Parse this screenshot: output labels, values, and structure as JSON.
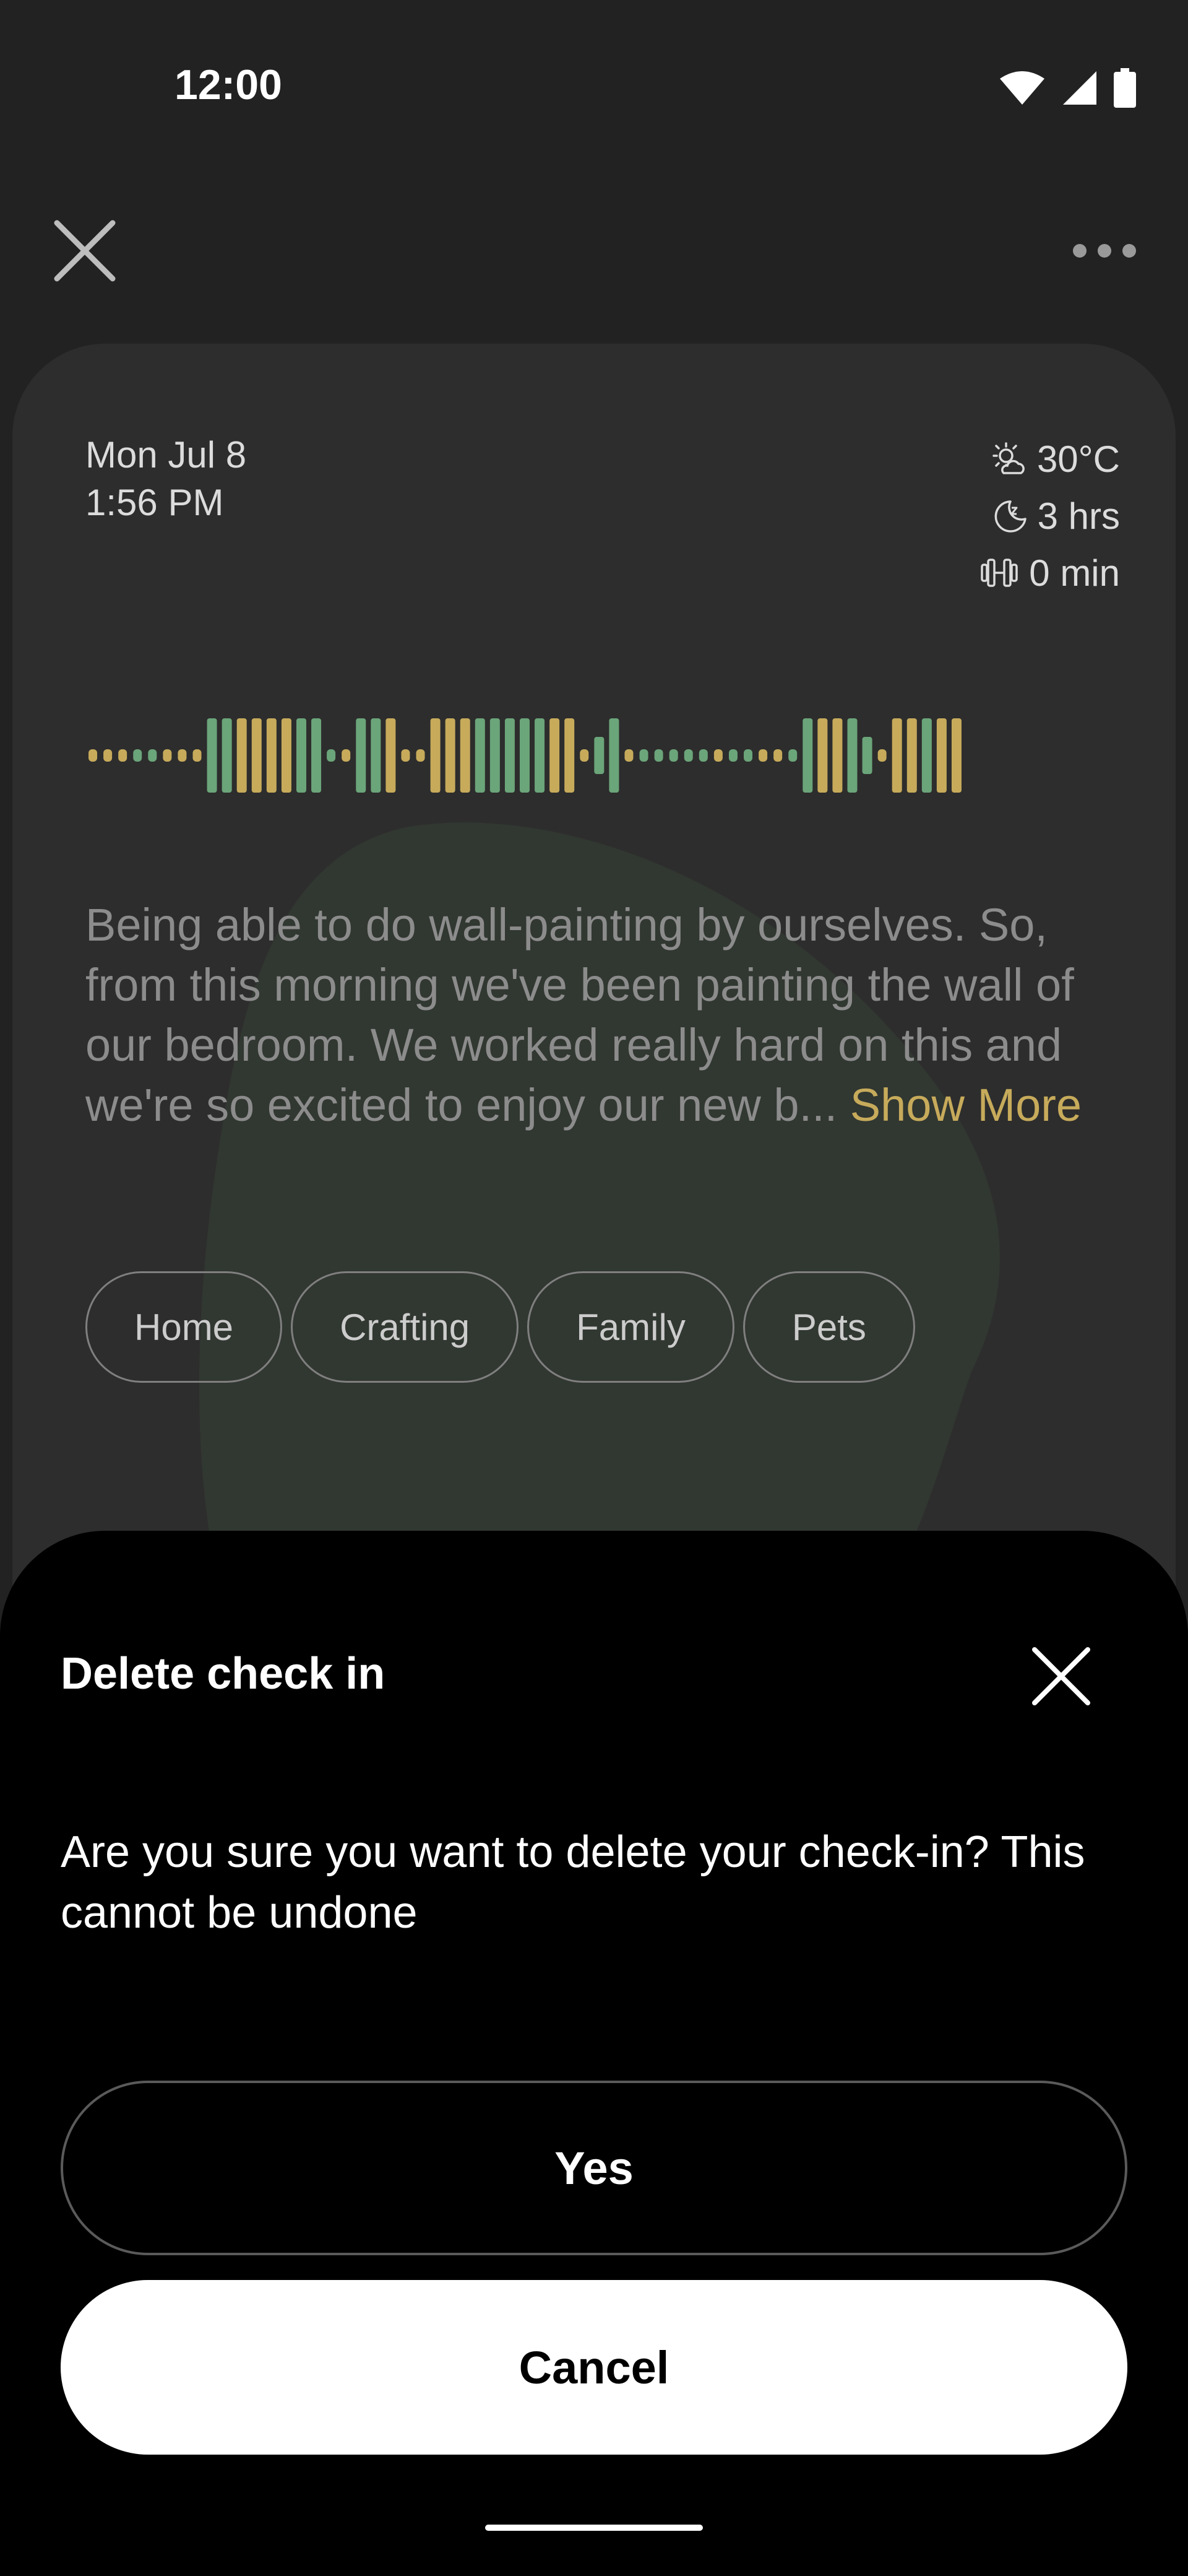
{
  "status_bar": {
    "time": "12:00",
    "icons": [
      "wifi-icon",
      "signal-icon",
      "battery-icon"
    ]
  },
  "top_bar": {
    "close_icon": "close-icon",
    "more_icon": "more-horizontal-icon"
  },
  "entry": {
    "date": "Mon Jul 8",
    "time": "1:56 PM",
    "weather": "30°C",
    "sleep": "3 hrs",
    "exercise": "0 min",
    "text": "Being able to do wall-painting by ourselves. So, from this morning we've been painting the wall of our bedroom. We worked really hard on this and we're so excited to enjoy our new b...",
    "show_more": "Show More",
    "tags": [
      "Home",
      "Crafting",
      "Family",
      "Pets"
    ]
  },
  "colors": {
    "waveform_green": "#6ba57a",
    "waveform_gold": "#c7ab5b",
    "accent": "#c7ab5b"
  },
  "dialog": {
    "title": "Delete check in",
    "message": "Are you sure you want to delete your check-in? This cannot be undone",
    "yes_label": "Yes",
    "cancel_label": "Cancel"
  }
}
